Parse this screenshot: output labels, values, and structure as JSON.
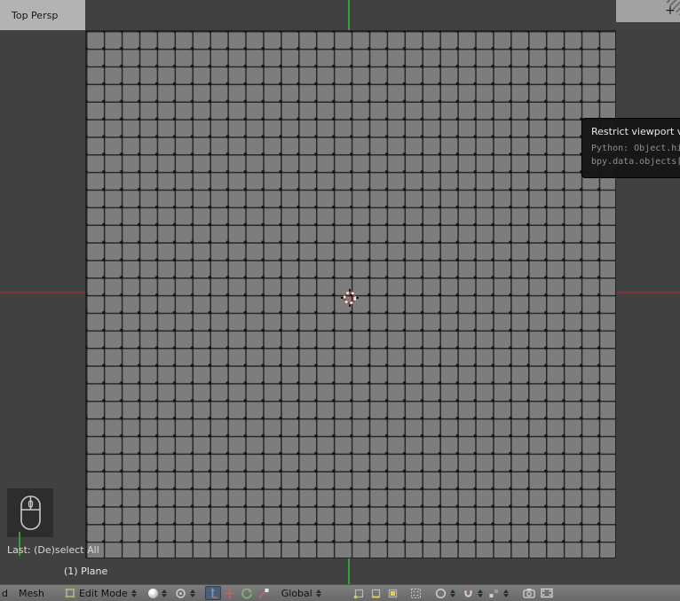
{
  "viewport": {
    "view_label": "Top Persp",
    "last_operator": "Last: (De)select All",
    "object_info": "(1) Plane",
    "add_region_button": "+"
  },
  "tooltip": {
    "title": "Restrict viewport vis",
    "python_lines": [
      "Python: Object.hi",
      "bpy.data.objects["
    ]
  },
  "header": {
    "menus": {
      "partial": "d",
      "mesh": "Mesh"
    },
    "mode": "Edit Mode",
    "orientation": "Global"
  },
  "colors": {
    "axis_x": "#7e3434",
    "axis_y": "#38a038",
    "grid_face": "#7d7d7d",
    "grid_line": "#272727",
    "header_bg": "#6e6e6e",
    "tooltip_bg": "#161616",
    "active_button": "#4a5f76"
  },
  "icons": {
    "mode": "editmode-cube-icon",
    "shading": "sphere-icon",
    "pivot": "pivot-median-icon",
    "manipulators": [
      "axis-arrows-icon",
      "translate-arrows-icon",
      "rotate-arc-icon",
      "scale-icon"
    ],
    "select_modes": [
      "vertex-select-icon",
      "edge-select-icon",
      "face-select-icon"
    ],
    "occlude": "dotted-grid-icon",
    "proportional": "circle-icon",
    "snap": "magnet-icon",
    "snap_target": "increment-icon",
    "render": [
      "camera-icon",
      "film-icon"
    ]
  }
}
